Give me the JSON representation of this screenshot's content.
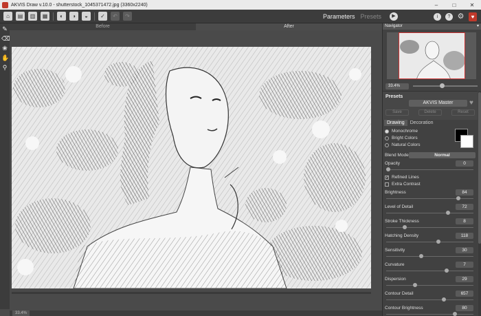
{
  "window": {
    "title": "AKVIS Draw v.10.0 - shutterstock_1045371472.jpg (3360x2240)",
    "controls": [
      "–",
      "□",
      "✕"
    ]
  },
  "toolbar": {
    "right_tabs": {
      "parameters": "Parameters",
      "presets": "Presets"
    }
  },
  "canvas": {
    "tabs": {
      "before": "Before",
      "after": "After"
    },
    "status_zoom": "33.4%"
  },
  "navigator": {
    "title": "Navigator",
    "zoom": "33.4%",
    "zoom_slider_fraction": 0.42
  },
  "presets": {
    "title": "Presets",
    "selected": "AKVIS Master",
    "buttons": {
      "save": "Save",
      "delete": "Delete",
      "reset": "Reset"
    }
  },
  "settings": {
    "tabs": {
      "drawing": "Drawing",
      "decoration": "Decoration"
    },
    "color_modes": [
      {
        "label": "Monochrome",
        "selected": true
      },
      {
        "label": "Bright Colors",
        "selected": false
      },
      {
        "label": "Natural Colors",
        "selected": false
      }
    ],
    "blend_mode_label": "Blend Mode",
    "blend_mode_value": "Normal",
    "opacity": {
      "label": "Opacity",
      "value": "0",
      "fraction": 0.0
    },
    "refined_lines": {
      "label": "Refined Lines",
      "checked": true
    },
    "extra_contrast": {
      "label": "Extra Contrast",
      "checked": false
    },
    "params": [
      {
        "label": "Brightness",
        "value": "84",
        "fraction": 0.84
      },
      {
        "label": "Level of Detail",
        "value": "72",
        "fraction": 0.72
      },
      {
        "label": "Stroke Thickness",
        "value": "8",
        "fraction": 0.2
      },
      {
        "label": "Hatching Density",
        "value": "118",
        "fraction": 0.6
      },
      {
        "label": "Sensitivity",
        "value": "30",
        "fraction": 0.4
      },
      {
        "label": "Curvature",
        "value": "7",
        "fraction": 0.7
      },
      {
        "label": "Dispersion",
        "value": "29",
        "fraction": 0.32
      },
      {
        "label": "Contour Detail",
        "value": "657",
        "fraction": 0.67
      },
      {
        "label": "Contour Brightness",
        "value": "80",
        "fraction": 0.8
      }
    ]
  }
}
